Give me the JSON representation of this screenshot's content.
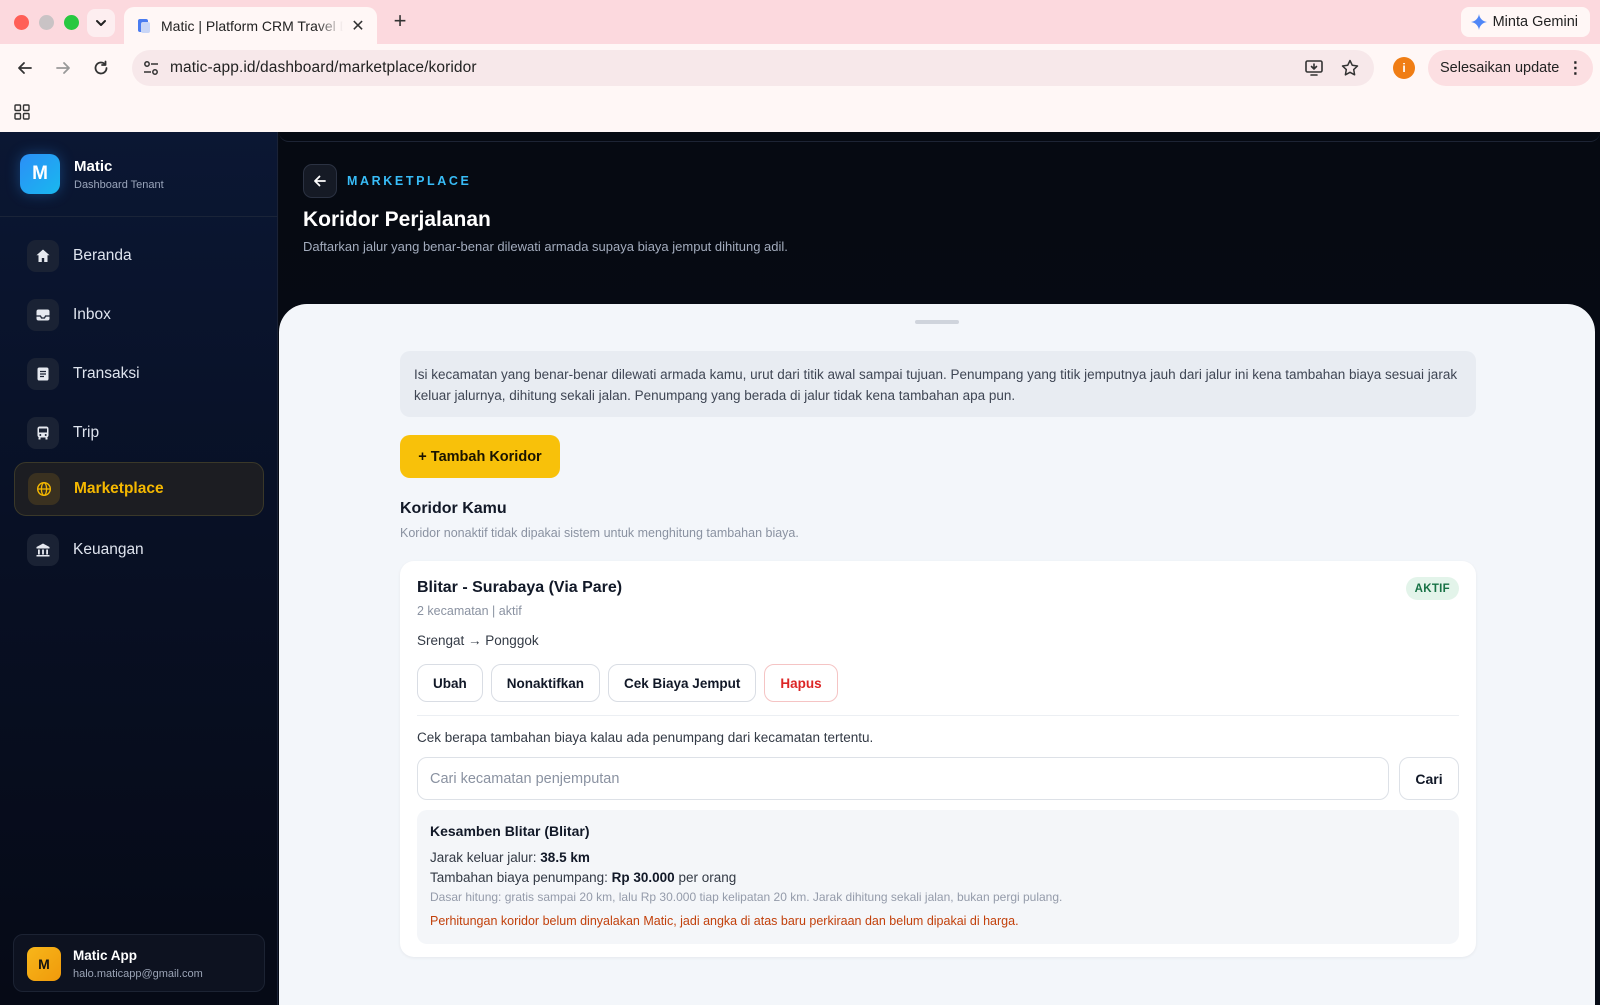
{
  "browser": {
    "tab_title": "Matic | Platform CRM Travel Dashboard",
    "tab_close": "✕",
    "new_tab": "+",
    "url": "matic-app.id/dashboard/marketplace/koridor",
    "gemini_label": "Minta Gemini",
    "profile_initial": "i",
    "update_label": "Selesaikan update",
    "update_menu": "⋮",
    "colors": {
      "tabbar": "#fcd9de",
      "toolbar": "#fff7f6",
      "profile": "#f07d14"
    }
  },
  "sidebar": {
    "brand_initial": "M",
    "brand_name": "Matic",
    "brand_sub": "Dashboard Tenant",
    "items": [
      {
        "label": "Beranda",
        "icon": "home-icon"
      },
      {
        "label": "Inbox",
        "icon": "inbox-icon"
      },
      {
        "label": "Transaksi",
        "icon": "document-icon"
      },
      {
        "label": "Trip",
        "icon": "bus-icon"
      },
      {
        "label": "Marketplace",
        "icon": "globe-icon",
        "active": true
      },
      {
        "label": "Keuangan",
        "icon": "bank-icon"
      }
    ],
    "user": {
      "initial": "M",
      "name": "Matic App",
      "email": "halo.maticapp@gmail.com"
    }
  },
  "header": {
    "eyebrow": "MARKETPLACE",
    "title": "Koridor Perjalanan",
    "subtitle": "Daftarkan jalur yang benar-benar dilewati armada supaya biaya jemput dihitung adil."
  },
  "content": {
    "notice": "Isi kecamatan yang benar-benar dilewati armada kamu, urut dari titik awal sampai tujuan. Penumpang yang titik jemputnya jauh dari jalur ini kena tambahan biaya sesuai jarak keluar jalurnya, dihitung sekali jalan. Penumpang yang berada di jalur tidak kena tambahan apa pun.",
    "add_button": "+ Tambah Koridor",
    "section_title": "Koridor Kamu",
    "section_sub": "Koridor nonaktif tidak dipakai sistem untuk menghitung tambahan biaya.",
    "corridor": {
      "name": "Blitar - Surabaya (Via Pare)",
      "status": "AKTIF",
      "meta": "2 kecamatan | aktif",
      "route": "Srengat → Ponggok",
      "actions": {
        "edit": "Ubah",
        "deactivate": "Nonaktifkan",
        "check_fee": "Cek Biaya Jemput",
        "delete": "Hapus"
      },
      "check_label": "Cek berapa tambahan biaya kalau ada penumpang dari kecamatan tertentu.",
      "search_placeholder": "Cari kecamatan penjemputan",
      "search_value": "",
      "search_button": "Cari",
      "result": {
        "title": "Kesamben Blitar (Blitar)",
        "distance_label": "Jarak keluar jalur: ",
        "distance_value": "38.5 km",
        "fee_label": "Tambahan biaya penumpang: ",
        "fee_value": "Rp 30.000",
        "fee_suffix": " per orang",
        "basis": "Dasar hitung: gratis sampai 20 km, lalu Rp 30.000 tiap kelipatan 20 km. Jarak dihitung sekali jalan, bukan pergi pulang.",
        "warning": "Perhitungan koridor belum dinyalakan Matic, jadi angka di atas baru perkiraan dan belum dipakai di harga."
      }
    }
  },
  "colors": {
    "accent": "#f8c10a",
    "active_text": "#f5b800",
    "eyebrow": "#38bdf8",
    "danger": "#dc2626",
    "warning": "#c2410c",
    "badge_bg": "#e3f4ea",
    "badge_text": "#177245"
  }
}
